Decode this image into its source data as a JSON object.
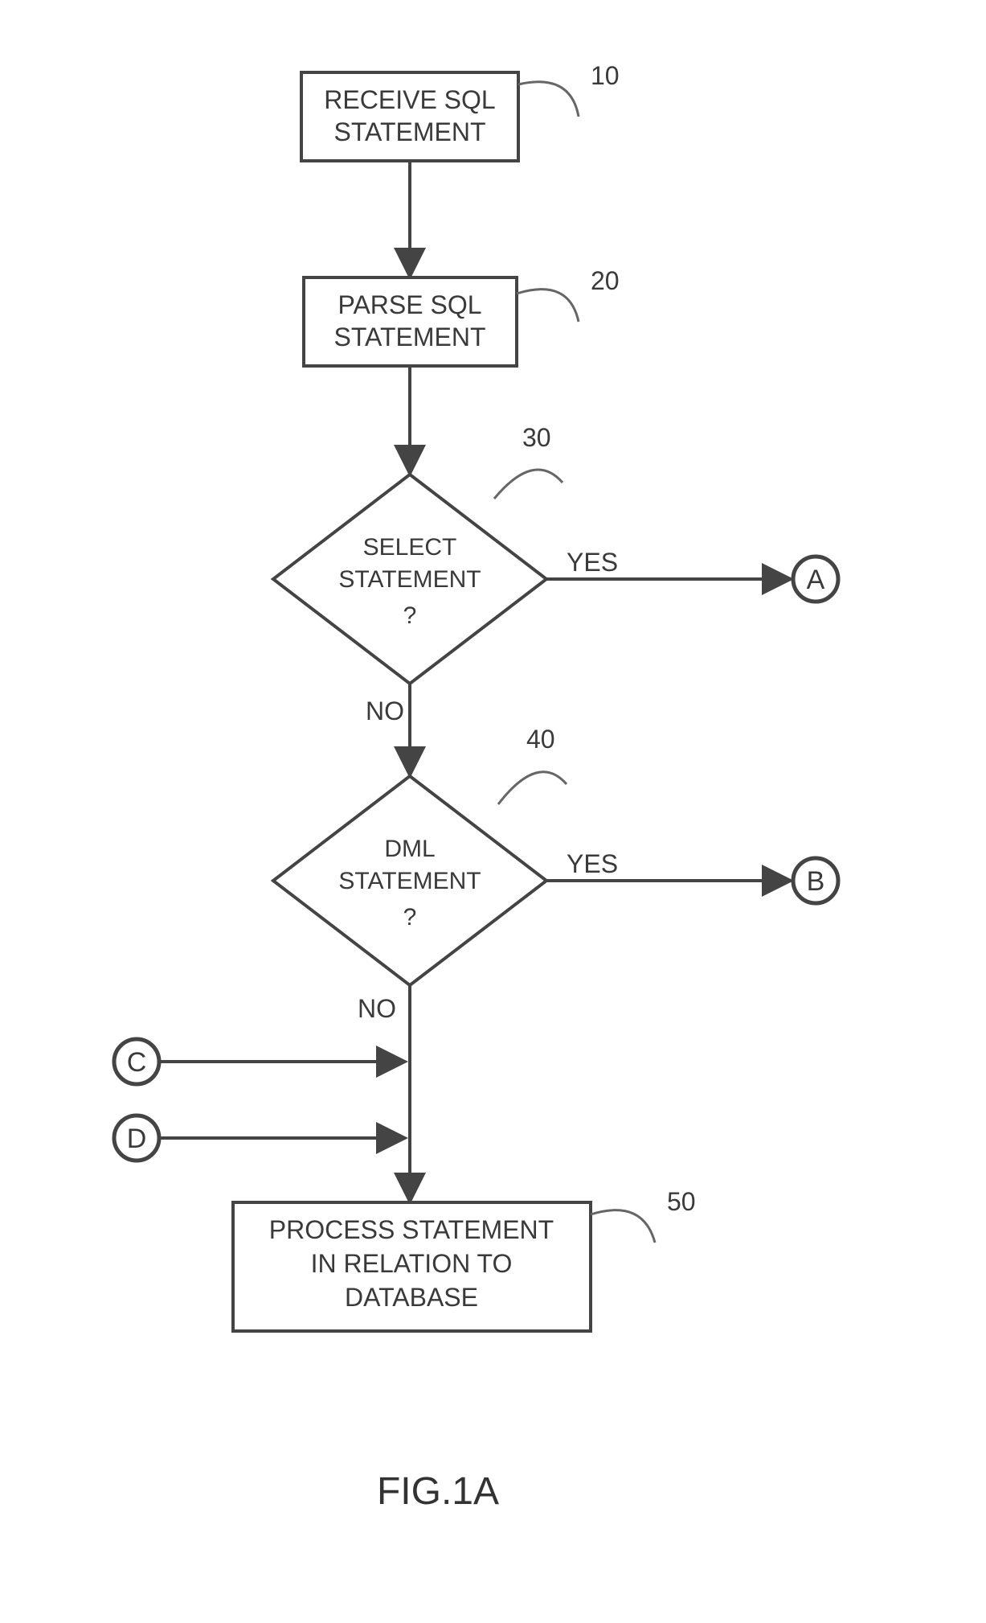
{
  "nodes": {
    "receive": {
      "line1": "RECEIVE SQL",
      "line2": "STATEMENT",
      "ref": "10"
    },
    "parse": {
      "line1": "PARSE SQL",
      "line2": "STATEMENT",
      "ref": "20"
    },
    "select_decision": {
      "line1": "SELECT",
      "line2": "STATEMENT",
      "line3": "?",
      "ref": "30",
      "yes": "YES",
      "no": "NO"
    },
    "dml_decision": {
      "line1": "DML",
      "line2": "STATEMENT",
      "line3": "?",
      "ref": "40",
      "yes": "YES",
      "no": "NO"
    },
    "process": {
      "line1": "PROCESS STATEMENT",
      "line2": "IN RELATION TO",
      "line3": "DATABASE",
      "ref": "50"
    }
  },
  "connectors": {
    "a": "A",
    "b": "B",
    "c": "C",
    "d": "D"
  },
  "figure": "FIG.1A"
}
